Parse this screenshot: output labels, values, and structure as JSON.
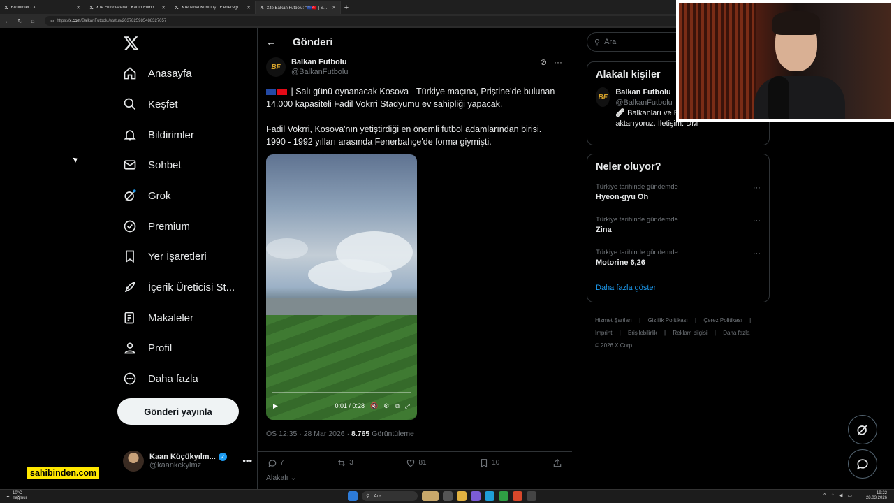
{
  "browser": {
    "tabs": [
      {
        "title": "Bildirimler / X",
        "active": false
      },
      {
        "title": "X'te FutbolArena: \"Kadın Futbol Sü",
        "active": false
      },
      {
        "title": "X'te Nihat Kurtuluş: \"Eleneceğiz ke",
        "active": false
      },
      {
        "title": "X'te Balkan Futbolu: \"🇽🇰🇹🇷 | Salı gü",
        "active": true
      }
    ],
    "url_prefix": "https://",
    "url_domain": "x.com",
    "url_path": "/BalkanFutbolu/status/2037825985488327057"
  },
  "nav": {
    "items": [
      {
        "label": "Anasayfa",
        "icon": "home-icon"
      },
      {
        "label": "Keşfet",
        "icon": "search-icon"
      },
      {
        "label": "Bildirimler",
        "icon": "bell-icon"
      },
      {
        "label": "Sohbet",
        "icon": "mail-icon"
      },
      {
        "label": "Grok",
        "icon": "grok-icon"
      },
      {
        "label": "Premium",
        "icon": "verified-icon"
      },
      {
        "label": "Yer İşaretleri",
        "icon": "bookmark-icon"
      },
      {
        "label": "İçerik Üreticisi St...",
        "icon": "rocket-icon"
      },
      {
        "label": "Makaleler",
        "icon": "article-icon"
      },
      {
        "label": "Profil",
        "icon": "person-icon"
      },
      {
        "label": "Daha fazla",
        "icon": "more-circle-icon"
      }
    ],
    "post_button": "Gönderi yayınla",
    "account": {
      "name": "Kaan Küçükyılm...",
      "handle": "@kaankckylmz"
    }
  },
  "post": {
    "header_title": "Gönderi",
    "author_name": "Balkan Futbolu",
    "author_handle": "@BalkanFutbolu",
    "logo_text": "BF",
    "paragraph1": "| Salı günü oynanacak Kosova - Türkiye maçına, Priştine'de bulunan 14.000 kapasiteli Fadil Vokrri Stadyumu ev sahipliği yapacak.",
    "paragraph2": "Fadil Vokrri, Kosova'nın yetiştirdiği en önemli futbol adamlarından birisi. 1990 - 1992 yılları arasında Fenerbahçe'de forma giymişti.",
    "video_time": "0:01 / 0:28",
    "timestamp": "ÖS 12:35 · 28 Mar 2026 ·",
    "views_count": "8.765",
    "views_label": "Görüntüleme",
    "replies": "7",
    "reposts": "3",
    "likes": "81",
    "bookmarks": "10",
    "related_label": "Alakalı"
  },
  "right": {
    "search_placeholder": "Ara",
    "related_title": "Alakalı kişiler",
    "related_person": {
      "name": "Balkan Futbolu",
      "handle": "@BalkanFutbolu",
      "bio": "🩹 Balkanları ve Balkan futbolunu aktarıyoruz. İletişim: DM"
    },
    "trends_title": "Neler oluyor?",
    "trends": [
      {
        "context": "Türkiye tarihinde gündemde",
        "name": "Hyeon-gyu Oh"
      },
      {
        "context": "Türkiye tarihinde gündemde",
        "name": "Zina"
      },
      {
        "context": "Türkiye tarihinde gündemde",
        "name": "Motorine 6,26"
      }
    ],
    "show_more": "Daha fazla göster",
    "footer_links_row1": [
      "Hizmet Şartları",
      "|",
      "Gizlilik Politikası",
      "|",
      "Çerez Politikası",
      "|"
    ],
    "footer_links_row2": [
      "Imprint",
      "|",
      "Erişilebilirlik",
      "|",
      "Reklam bilgisi",
      "|",
      "Daha fazla ···"
    ],
    "copyright": "© 2026 X Corp."
  },
  "overlay": {
    "sponsor": "sahibinden.com"
  },
  "taskbar": {
    "temp": "10°C",
    "weather": "Yağmur",
    "search": "Ara",
    "time": "19:22",
    "date": "28.03.2026"
  },
  "colors": {
    "accent": "#1d9bf0",
    "background": "#000000",
    "border": "#2f3336",
    "muted_text": "#71767b",
    "sponsor_bg": "#ffe800"
  }
}
